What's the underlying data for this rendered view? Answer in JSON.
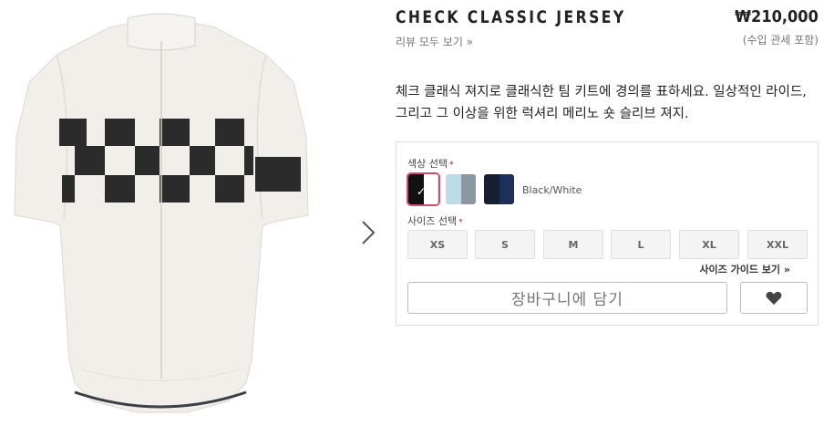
{
  "product": {
    "title": "CHECK CLASSIC JERSEY",
    "review_link": "리뷰 모두 보기 »",
    "price": "₩210,000",
    "price_note": "(수입 관세 포함)",
    "description": "체크 클래식 져지로 클래식한 팀 키트에 경의를 표하세요. 일상적인 라이드, 그리고 그 이상을 위한 럭셔리 메리노 숏 슬리브 져지."
  },
  "color_section": {
    "label": "색상 선택",
    "required_mark": "*",
    "selected_name": "Black/White",
    "swatches": [
      {
        "name": "black-white",
        "left": "#111111",
        "right": "#ffffff",
        "selected": true
      },
      {
        "name": "light-blue-grey",
        "left": "#bcdcea",
        "right": "#8b98a3",
        "selected": false
      },
      {
        "name": "navy",
        "left": "#162033",
        "right": "#1f2f5c",
        "selected": false
      }
    ]
  },
  "size_section": {
    "label": "사이즈 선택",
    "required_mark": "*",
    "sizes": [
      "XS",
      "S",
      "M",
      "L",
      "XL",
      "XXL"
    ],
    "guide_link": "사이즈 가이드 보기 »"
  },
  "actions": {
    "cart_label": "장바구니에 담기",
    "wishlist_icon": "heart-icon"
  },
  "colors": {
    "required": "#d0021b",
    "selected_outline": "#d44a6a"
  }
}
